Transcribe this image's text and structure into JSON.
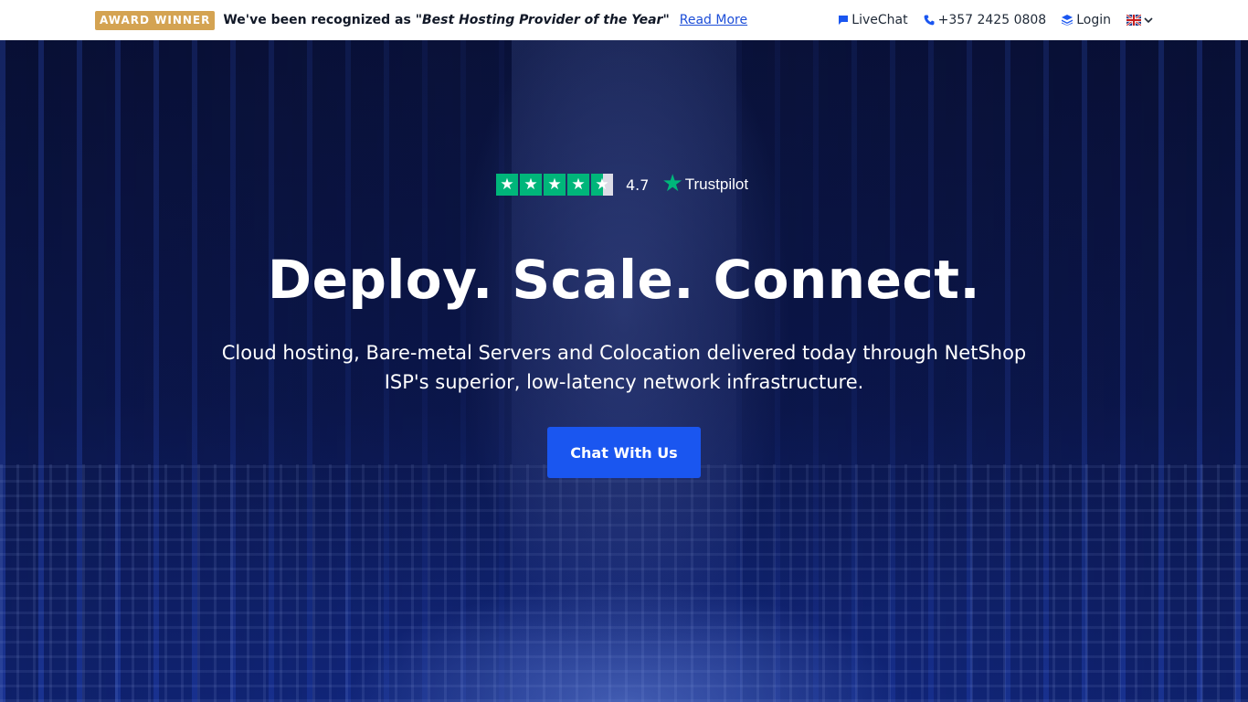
{
  "topbar": {
    "badge": "AWARD WINNER",
    "announce_prefix": "We've been recognized as",
    "announce_quote": "\"Best Hosting Provider of the Year\"",
    "read_more": "Read More",
    "livechat": "LiveChat",
    "phone": "+357 2425 0808",
    "login": "Login",
    "language_icon": "uk-flag-icon"
  },
  "hero": {
    "rating_value": "4.7",
    "stars": 4.5,
    "stars_total": 5,
    "trustpilot": "Trustpilot",
    "headline": "Deploy. Scale. Connect.",
    "subtitle": "Cloud hosting, Bare-metal Servers and Colocation delivered today through NetShop ISP's superior, low-latency network infrastructure.",
    "cta": "Chat With Us"
  },
  "colors": {
    "badge": "#d4a352",
    "accent": "#1a56f0",
    "trustpilot_green": "#00b67a"
  }
}
